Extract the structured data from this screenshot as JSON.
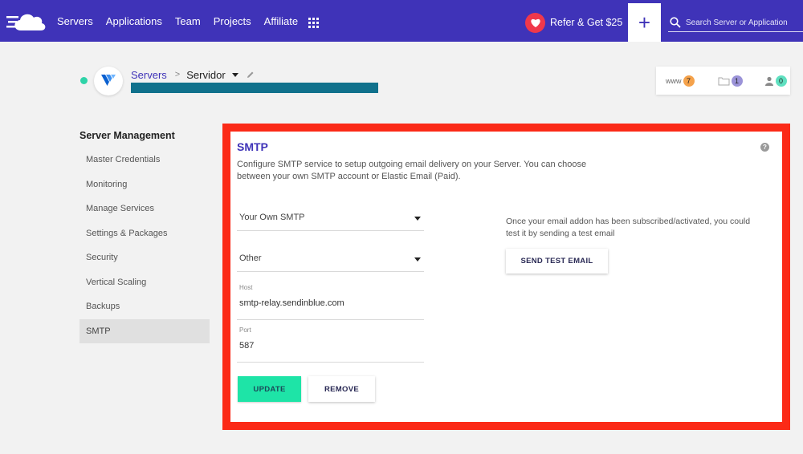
{
  "topbar": {
    "nav": [
      "Servers",
      "Applications",
      "Team",
      "Projects",
      "Affiliate"
    ],
    "refer_label": "Refer & Get $25",
    "plus_label": "+",
    "search_placeholder": "Search Server or Application"
  },
  "breadcrumb": {
    "servers": "Servers",
    "separator": ">",
    "current": "Servidor"
  },
  "counters": {
    "www": {
      "label": "www",
      "count": "7",
      "color": "#f5a24b"
    },
    "folders": {
      "count": "1",
      "color": "#9b93d8"
    },
    "users": {
      "count": "0",
      "color": "#5fe0c0"
    }
  },
  "sidebar": {
    "title": "Server Management",
    "items": [
      "Master Credentials",
      "Monitoring",
      "Manage Services",
      "Settings & Packages",
      "Security",
      "Vertical Scaling",
      "Backups",
      "SMTP"
    ]
  },
  "smtp": {
    "title": "SMTP",
    "help": "?",
    "description": "Configure SMTP service to setup outgoing email delivery on your Server. You can choose between your own SMTP account or Elastic Email (Paid).",
    "provider_select": "Your Own SMTP",
    "service_select": "Other",
    "host_label": "Host",
    "host_value": "smtp-relay.sendinblue.com",
    "port_label": "Port",
    "port_value": "587",
    "update_label": "UPDATE",
    "remove_label": "REMOVE",
    "test_note": "Once your email addon has been subscribed/activated, you could test it by sending a test email",
    "test_button": "SEND TEST EMAIL"
  },
  "colors": {
    "brand": "#3f33b8",
    "accent": "#1ee4a7",
    "highlight": "#fb2a17",
    "status": "#2ed3a8"
  }
}
